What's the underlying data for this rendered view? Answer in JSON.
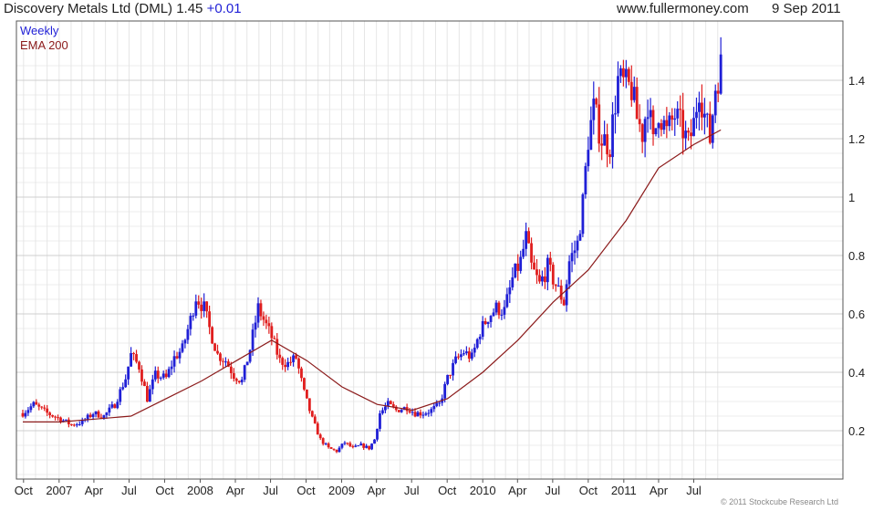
{
  "header": {
    "title": "Discovery Metals Ltd (DML) 1.45",
    "change": "+0.01",
    "site": "www.fullermoney.com",
    "date": "9 Sep 2011"
  },
  "legend": {
    "weekly": "Weekly",
    "ema": "EMA 200"
  },
  "credit": "© 2011 Stockcube Research Ltd",
  "colors": {
    "up": "#1f1fd6",
    "down": "#e01e1e",
    "ema": "#8b1a1a",
    "grid": "#d9d9d9",
    "frame": "#555555"
  },
  "chart_data": {
    "type": "candlestick",
    "interval": "weekly",
    "yticks": [
      0.2,
      0.4,
      0.6,
      0.8,
      1,
      1.2,
      1.4
    ],
    "ylim": [
      0.2,
      1.4
    ],
    "xticks": [
      "Oct",
      "2007",
      "Apr",
      "Jul",
      "Oct",
      "2008",
      "Apr",
      "Jul",
      "Oct",
      "2009",
      "Apr",
      "Jul",
      "Oct",
      "2010",
      "Apr",
      "Jul",
      "Oct",
      "2011",
      "Apr",
      "Jul"
    ],
    "ema_label": "EMA 200",
    "close_path": [
      {
        "t": "2006-09-29",
        "v": 0.26
      },
      {
        "t": "2006-10-27",
        "v": 0.29
      },
      {
        "t": "2006-12-01",
        "v": 0.26
      },
      {
        "t": "2007-01-05",
        "v": 0.24
      },
      {
        "t": "2007-02-02",
        "v": 0.22
      },
      {
        "t": "2007-03-02",
        "v": 0.23
      },
      {
        "t": "2007-03-30",
        "v": 0.26
      },
      {
        "t": "2007-04-27",
        "v": 0.25
      },
      {
        "t": "2007-05-25",
        "v": 0.29
      },
      {
        "t": "2007-06-22",
        "v": 0.38
      },
      {
        "t": "2007-07-06",
        "v": 0.46
      },
      {
        "t": "2007-07-27",
        "v": 0.42
      },
      {
        "t": "2007-08-17",
        "v": 0.31
      },
      {
        "t": "2007-09-07",
        "v": 0.39
      },
      {
        "t": "2007-10-05",
        "v": 0.38
      },
      {
        "t": "2007-10-26",
        "v": 0.45
      },
      {
        "t": "2007-11-16",
        "v": 0.48
      },
      {
        "t": "2007-12-07",
        "v": 0.58
      },
      {
        "t": "2007-12-21",
        "v": 0.66
      },
      {
        "t": "2008-01-11",
        "v": 0.62
      },
      {
        "t": "2008-01-25",
        "v": 0.55
      },
      {
        "t": "2008-02-15",
        "v": 0.46
      },
      {
        "t": "2008-03-07",
        "v": 0.44
      },
      {
        "t": "2008-03-28",
        "v": 0.39
      },
      {
        "t": "2008-04-18",
        "v": 0.37
      },
      {
        "t": "2008-05-09",
        "v": 0.48
      },
      {
        "t": "2008-05-30",
        "v": 0.62
      },
      {
        "t": "2008-06-13",
        "v": 0.58
      },
      {
        "t": "2008-07-04",
        "v": 0.52
      },
      {
        "t": "2008-07-25",
        "v": 0.44
      },
      {
        "t": "2008-08-15",
        "v": 0.43
      },
      {
        "t": "2008-09-05",
        "v": 0.45
      },
      {
        "t": "2008-09-26",
        "v": 0.33
      },
      {
        "t": "2008-10-17",
        "v": 0.24
      },
      {
        "t": "2008-11-07",
        "v": 0.17
      },
      {
        "t": "2008-11-28",
        "v": 0.14
      },
      {
        "t": "2008-12-19",
        "v": 0.13
      },
      {
        "t": "2009-01-09",
        "v": 0.16
      },
      {
        "t": "2009-01-30",
        "v": 0.14
      },
      {
        "t": "2009-02-20",
        "v": 0.15
      },
      {
        "t": "2009-03-13",
        "v": 0.14
      },
      {
        "t": "2009-03-27",
        "v": 0.17
      },
      {
        "t": "2009-04-10",
        "v": 0.26
      },
      {
        "t": "2009-05-01",
        "v": 0.29
      },
      {
        "t": "2009-05-22",
        "v": 0.27
      },
      {
        "t": "2009-06-19",
        "v": 0.28
      },
      {
        "t": "2009-07-10",
        "v": 0.26
      },
      {
        "t": "2009-07-31",
        "v": 0.26
      },
      {
        "t": "2009-08-21",
        "v": 0.27
      },
      {
        "t": "2009-09-11",
        "v": 0.29
      },
      {
        "t": "2009-10-02",
        "v": 0.38
      },
      {
        "t": "2009-10-23",
        "v": 0.44
      },
      {
        "t": "2009-11-13",
        "v": 0.47
      },
      {
        "t": "2009-12-04",
        "v": 0.45
      },
      {
        "t": "2009-12-25",
        "v": 0.54
      },
      {
        "t": "2010-01-15",
        "v": 0.59
      },
      {
        "t": "2010-02-05",
        "v": 0.62
      },
      {
        "t": "2010-02-26",
        "v": 0.61
      },
      {
        "t": "2010-03-19",
        "v": 0.72
      },
      {
        "t": "2010-04-09",
        "v": 0.78
      },
      {
        "t": "2010-04-23",
        "v": 0.86
      },
      {
        "t": "2010-05-07",
        "v": 0.76
      },
      {
        "t": "2010-05-28",
        "v": 0.7
      },
      {
        "t": "2010-06-18",
        "v": 0.76
      },
      {
        "t": "2010-07-09",
        "v": 0.7
      },
      {
        "t": "2010-07-30",
        "v": 0.64
      },
      {
        "t": "2010-08-13",
        "v": 0.78
      },
      {
        "t": "2010-09-03",
        "v": 0.84
      },
      {
        "t": "2010-09-17",
        "v": 0.98
      },
      {
        "t": "2010-10-01",
        "v": 1.2
      },
      {
        "t": "2010-10-15",
        "v": 1.3
      },
      {
        "t": "2010-11-05",
        "v": 1.2
      },
      {
        "t": "2010-11-26",
        "v": 1.18
      },
      {
        "t": "2010-12-17",
        "v": 1.4
      },
      {
        "t": "2011-01-07",
        "v": 1.38
      },
      {
        "t": "2011-01-21",
        "v": 1.37
      },
      {
        "t": "2011-02-04",
        "v": 1.27
      },
      {
        "t": "2011-02-18",
        "v": 1.22
      },
      {
        "t": "2011-03-04",
        "v": 1.33
      },
      {
        "t": "2011-03-18",
        "v": 1.18
      },
      {
        "t": "2011-04-01",
        "v": 1.3
      },
      {
        "t": "2011-04-22",
        "v": 1.22
      },
      {
        "t": "2011-05-13",
        "v": 1.28
      },
      {
        "t": "2011-06-03",
        "v": 1.23
      },
      {
        "t": "2011-06-17",
        "v": 1.18
      },
      {
        "t": "2011-07-01",
        "v": 1.25
      },
      {
        "t": "2011-07-15",
        "v": 1.38
      },
      {
        "t": "2011-07-29",
        "v": 1.28
      },
      {
        "t": "2011-08-12",
        "v": 1.2
      },
      {
        "t": "2011-08-26",
        "v": 1.38
      },
      {
        "t": "2011-09-09",
        "v": 1.45
      }
    ],
    "ema": [
      {
        "t": "2006-09-29",
        "v": 0.23
      },
      {
        "t": "2007-01-05",
        "v": 0.23
      },
      {
        "t": "2007-04-06",
        "v": 0.24
      },
      {
        "t": "2007-07-06",
        "v": 0.25
      },
      {
        "t": "2007-10-05",
        "v": 0.31
      },
      {
        "t": "2008-01-04",
        "v": 0.37
      },
      {
        "t": "2008-04-04",
        "v": 0.44
      },
      {
        "t": "2008-07-04",
        "v": 0.51
      },
      {
        "t": "2008-10-03",
        "v": 0.44
      },
      {
        "t": "2009-01-02",
        "v": 0.35
      },
      {
        "t": "2009-04-03",
        "v": 0.29
      },
      {
        "t": "2009-07-03",
        "v": 0.27
      },
      {
        "t": "2009-10-02",
        "v": 0.31
      },
      {
        "t": "2010-01-01",
        "v": 0.4
      },
      {
        "t": "2010-04-02",
        "v": 0.51
      },
      {
        "t": "2010-07-02",
        "v": 0.64
      },
      {
        "t": "2010-10-01",
        "v": 0.75
      },
      {
        "t": "2011-01-07",
        "v": 0.92
      },
      {
        "t": "2011-04-01",
        "v": 1.1
      },
      {
        "t": "2011-07-01",
        "v": 1.18
      },
      {
        "t": "2011-09-09",
        "v": 1.23
      }
    ]
  }
}
